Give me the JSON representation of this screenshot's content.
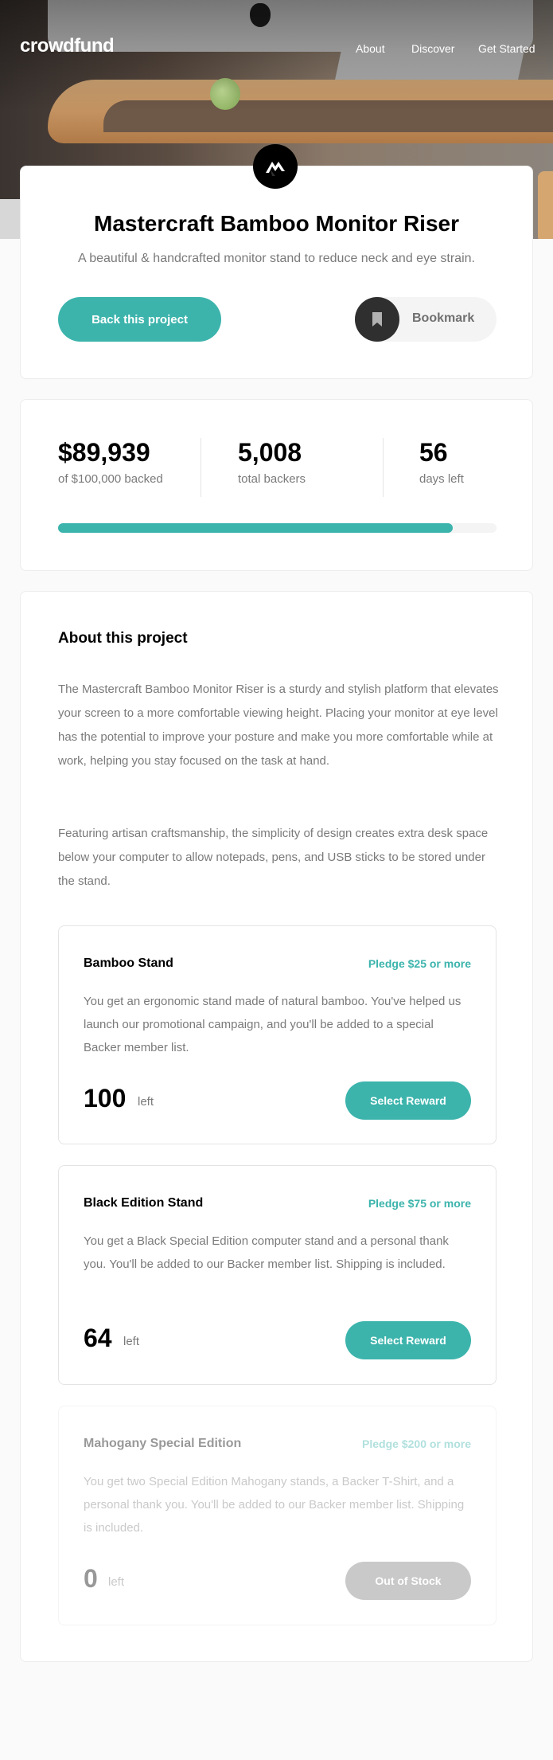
{
  "brand": {
    "logo": "crowdfund",
    "accent": "#3cb4ac"
  },
  "nav": {
    "links": [
      "About",
      "Discover",
      "Get Started"
    ]
  },
  "project": {
    "title": "Mastercraft Bamboo Monitor Riser",
    "subtitle": "A beautiful  & handcrafted monitor stand to reduce neck and eye strain.",
    "back_label": "Back this project",
    "bookmark_label": "Bookmark",
    "bookmark_icon": "bookmark-icon",
    "logo_icon": "mastercraft-logo-icon"
  },
  "stats": {
    "backed_amount": "$89,939",
    "backed_label": "of $100,000 backed",
    "backers": "5,008",
    "backers_label": "total backers",
    "days": "56",
    "days_label": "days left",
    "progress_fraction": 0.8994
  },
  "about": {
    "title": "About this project",
    "paragraphs": [
      "The Mastercraft Bamboo Monitor Riser is a sturdy and stylish platform that elevates your screen to a more comfortable viewing height. Placing your monitor at eye level has the potential to improve your posture and make you more comfortable while at work, helping you stay focused on the task at hand.",
      "Featuring artisan craftsmanship, the simplicity of design creates extra desk space below your computer to allow notepads, pens, and USB sticks to be stored under the stand."
    ]
  },
  "rewards": [
    {
      "name": "Bamboo Stand",
      "pledge": "Pledge $25 or more",
      "description": "You get an ergonomic stand made of natural bamboo. You've helped us launch our promotional campaign, and you'll be added to a special Backer member list.",
      "count": "100",
      "left_label": "left",
      "button": "Select Reward"
    },
    {
      "name": "Black Edition Stand",
      "pledge": "Pledge $75 or more",
      "description": "You get a Black Special Edition computer stand and a personal thank you. You'll be added to our Backer member list. Shipping is included.",
      "count": "64",
      "left_label": "left",
      "button": "Select Reward"
    },
    {
      "name": "Mahogany Special Edition",
      "pledge": "Pledge $200 or more",
      "description": "You get two Special Edition Mahogany stands, a Backer T-Shirt, and a personal thank you. You'll be added to our Backer member list. Shipping is included.",
      "count": "0",
      "left_label": "left",
      "button": "Out of Stock"
    }
  ]
}
